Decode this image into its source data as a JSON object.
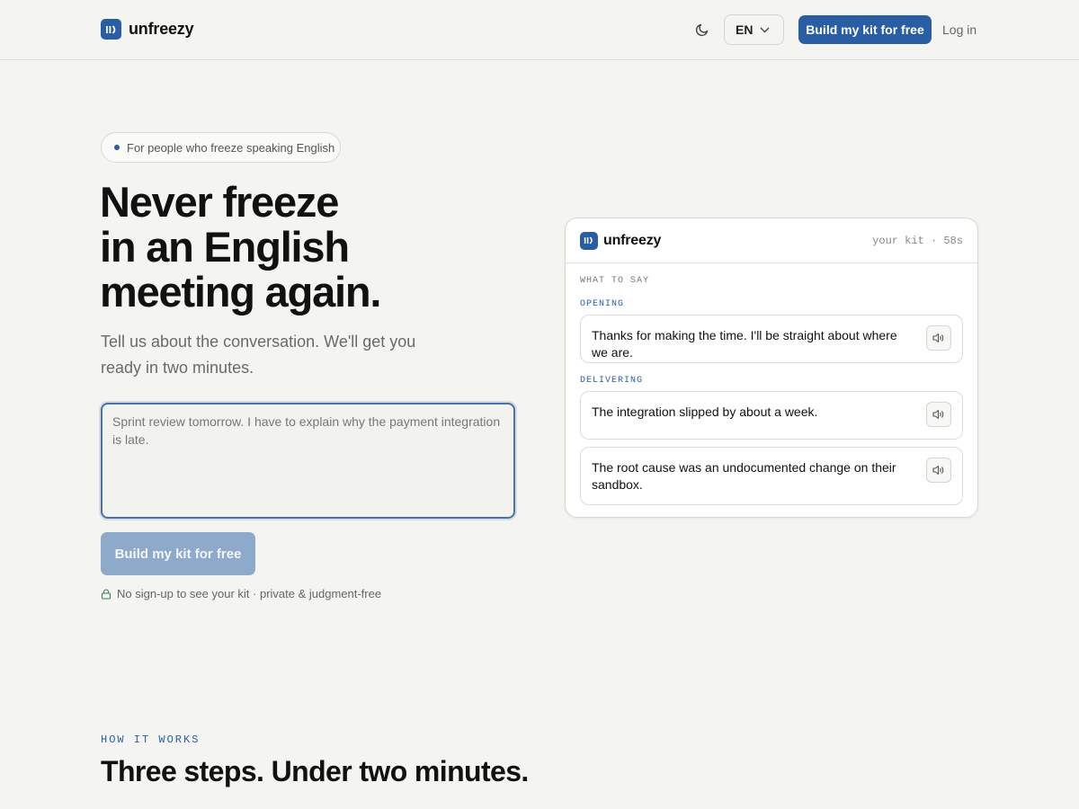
{
  "brand": {
    "name": "unfreezy",
    "logo_glyph": "II)",
    "color": "#2a5ea4"
  },
  "header": {
    "theme_icon": "moon-icon",
    "language": "EN",
    "cta_label": "Build my kit for free",
    "login_label": "Log in"
  },
  "hero": {
    "pill_text": "For people who freeze speaking English",
    "headline_lines": [
      "Never freeze",
      "in an English",
      "meeting again."
    ],
    "subhead": "Tell us about the conversation. We'll get you ready in two minutes.",
    "input_placeholder": "Sprint review tomorrow. I have to explain why the payment integration is late.",
    "cta_label": "Build my kit for free",
    "note": "No sign-up to see your kit · private & judgment-free"
  },
  "kit_card": {
    "brand": "unfreezy",
    "meta": "your kit · 58s",
    "section_title": "WHAT TO SAY",
    "groups": [
      {
        "label": "OPENING",
        "phrases": [
          "Thanks for making the time. I'll be straight about where we are."
        ]
      },
      {
        "label": "DELIVERING",
        "phrases": [
          "The integration slipped by about a week.",
          "The root cause was an undocumented change on their sandbox."
        ]
      }
    ]
  },
  "how_it_works": {
    "eyebrow": "HOW IT WORKS",
    "title": "Three steps. Under two minutes."
  }
}
